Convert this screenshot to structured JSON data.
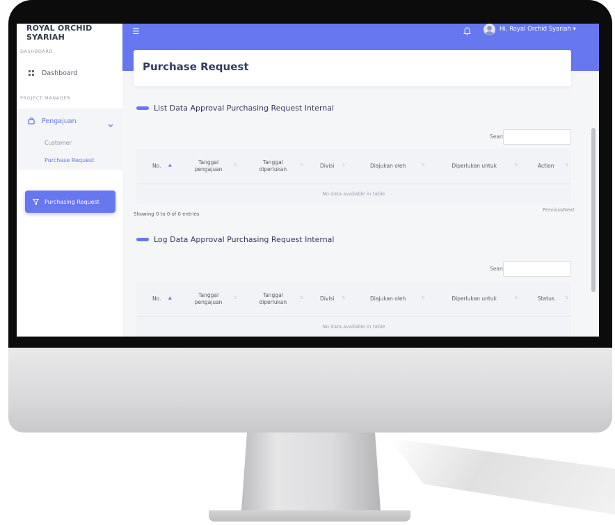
{
  "brand": "ROYAL ORCHID SYARIAH",
  "sidebar": {
    "sections": [
      {
        "label": "DASHBOARD"
      },
      {
        "label": "PROJECT MANAGER"
      }
    ],
    "dashboard_label": "Dashboard",
    "pengajuan_label": "Pengajuan",
    "subitems": [
      {
        "label": "Customer"
      },
      {
        "label": "Purchase Request"
      }
    ],
    "purchasing_request_label": "Purchasing Request"
  },
  "topbar": {
    "user_label": "Hi, Royal Orchid Syariah"
  },
  "page_title": "Purchase Request",
  "list_section": {
    "title": "List Data Approval Purchasing Request Internal",
    "search_label": "Search:",
    "columns": [
      "No.",
      "Tanggal\npengajuan",
      "Tanggal\ndiperlukan",
      "Divisi",
      "Diajukan oleh",
      "Diperlukan untuk",
      "Action"
    ],
    "empty_text": "No data available in table",
    "info": "Showing 0 to 0 of 0 entries",
    "pager": "PreviousNext"
  },
  "log_section": {
    "title": "Log Data Approval Purchasing Request Internal",
    "search_label": "Search:",
    "columns": [
      "No.",
      "Tanggal\npengajuan",
      "Tanggal\ndiperlukan",
      "Divisi",
      "Diajukan oleh",
      "Diperlukan untuk",
      "Status"
    ],
    "empty_text": "No data available in table"
  },
  "colors": {
    "accent": "#6777ef",
    "sidebar_bg": "#ffffff",
    "content_bg": "#f5f6f8"
  },
  "icons": [
    "menu-icon",
    "bell-icon",
    "user-avatar-icon",
    "dashboard-grid-icon",
    "briefcase-icon",
    "chevron-down-icon",
    "filter-icon"
  ]
}
